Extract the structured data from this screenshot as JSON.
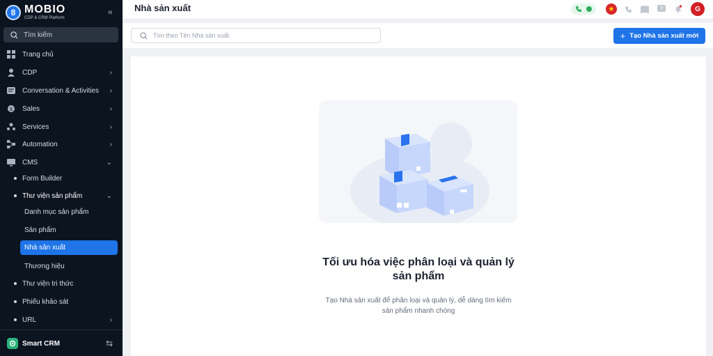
{
  "brand": {
    "title": "MOBIO",
    "subtitle": "CDP & CRM Platform"
  },
  "sidebar": {
    "search_label": "Tìm kiếm",
    "items": [
      {
        "label": "Trang chủ"
      },
      {
        "label": "CDP"
      },
      {
        "label": "Conversation & Activities"
      },
      {
        "label": "Sales"
      },
      {
        "label": "Services"
      },
      {
        "label": "Automation"
      },
      {
        "label": "CMS"
      }
    ],
    "cms_children": [
      {
        "label": "Form Builder"
      },
      {
        "label": "Thư viện sản phẩm"
      },
      {
        "label": "Thư viện tri thức"
      },
      {
        "label": "Phiếu khảo sát"
      },
      {
        "label": "URL"
      }
    ],
    "product_library_children": [
      {
        "label": "Danh mục sản phẩm"
      },
      {
        "label": "Sản phẩm"
      },
      {
        "label": "Nhà sản xuất"
      },
      {
        "label": "Thương hiệu"
      }
    ],
    "active_item": "Nhà sản xuất",
    "footer_label": "Smart CRM"
  },
  "header": {
    "title": "Nhà sản xuất",
    "avatar_initial": "G"
  },
  "toolbar": {
    "search_placeholder": "Tìm theo Tên Nhà sản xuất",
    "create_label": "Tạo Nhà sản xuất mới"
  },
  "empty_state": {
    "title_line1": "Tối ưu hóa việc phân loại và quản lý",
    "title_line2": "sản phẩm",
    "desc_line1": "Tạo Nhà sản xuất để phân loại và quản lý, dễ dàng tìm kiếm",
    "desc_line2": "sản phẩm nhanh chóng"
  },
  "colors": {
    "accent": "#1f74e8",
    "sidebar_bg": "#0c1420",
    "box_fill": "#b9ccf9",
    "tape": "#2b73ee"
  }
}
